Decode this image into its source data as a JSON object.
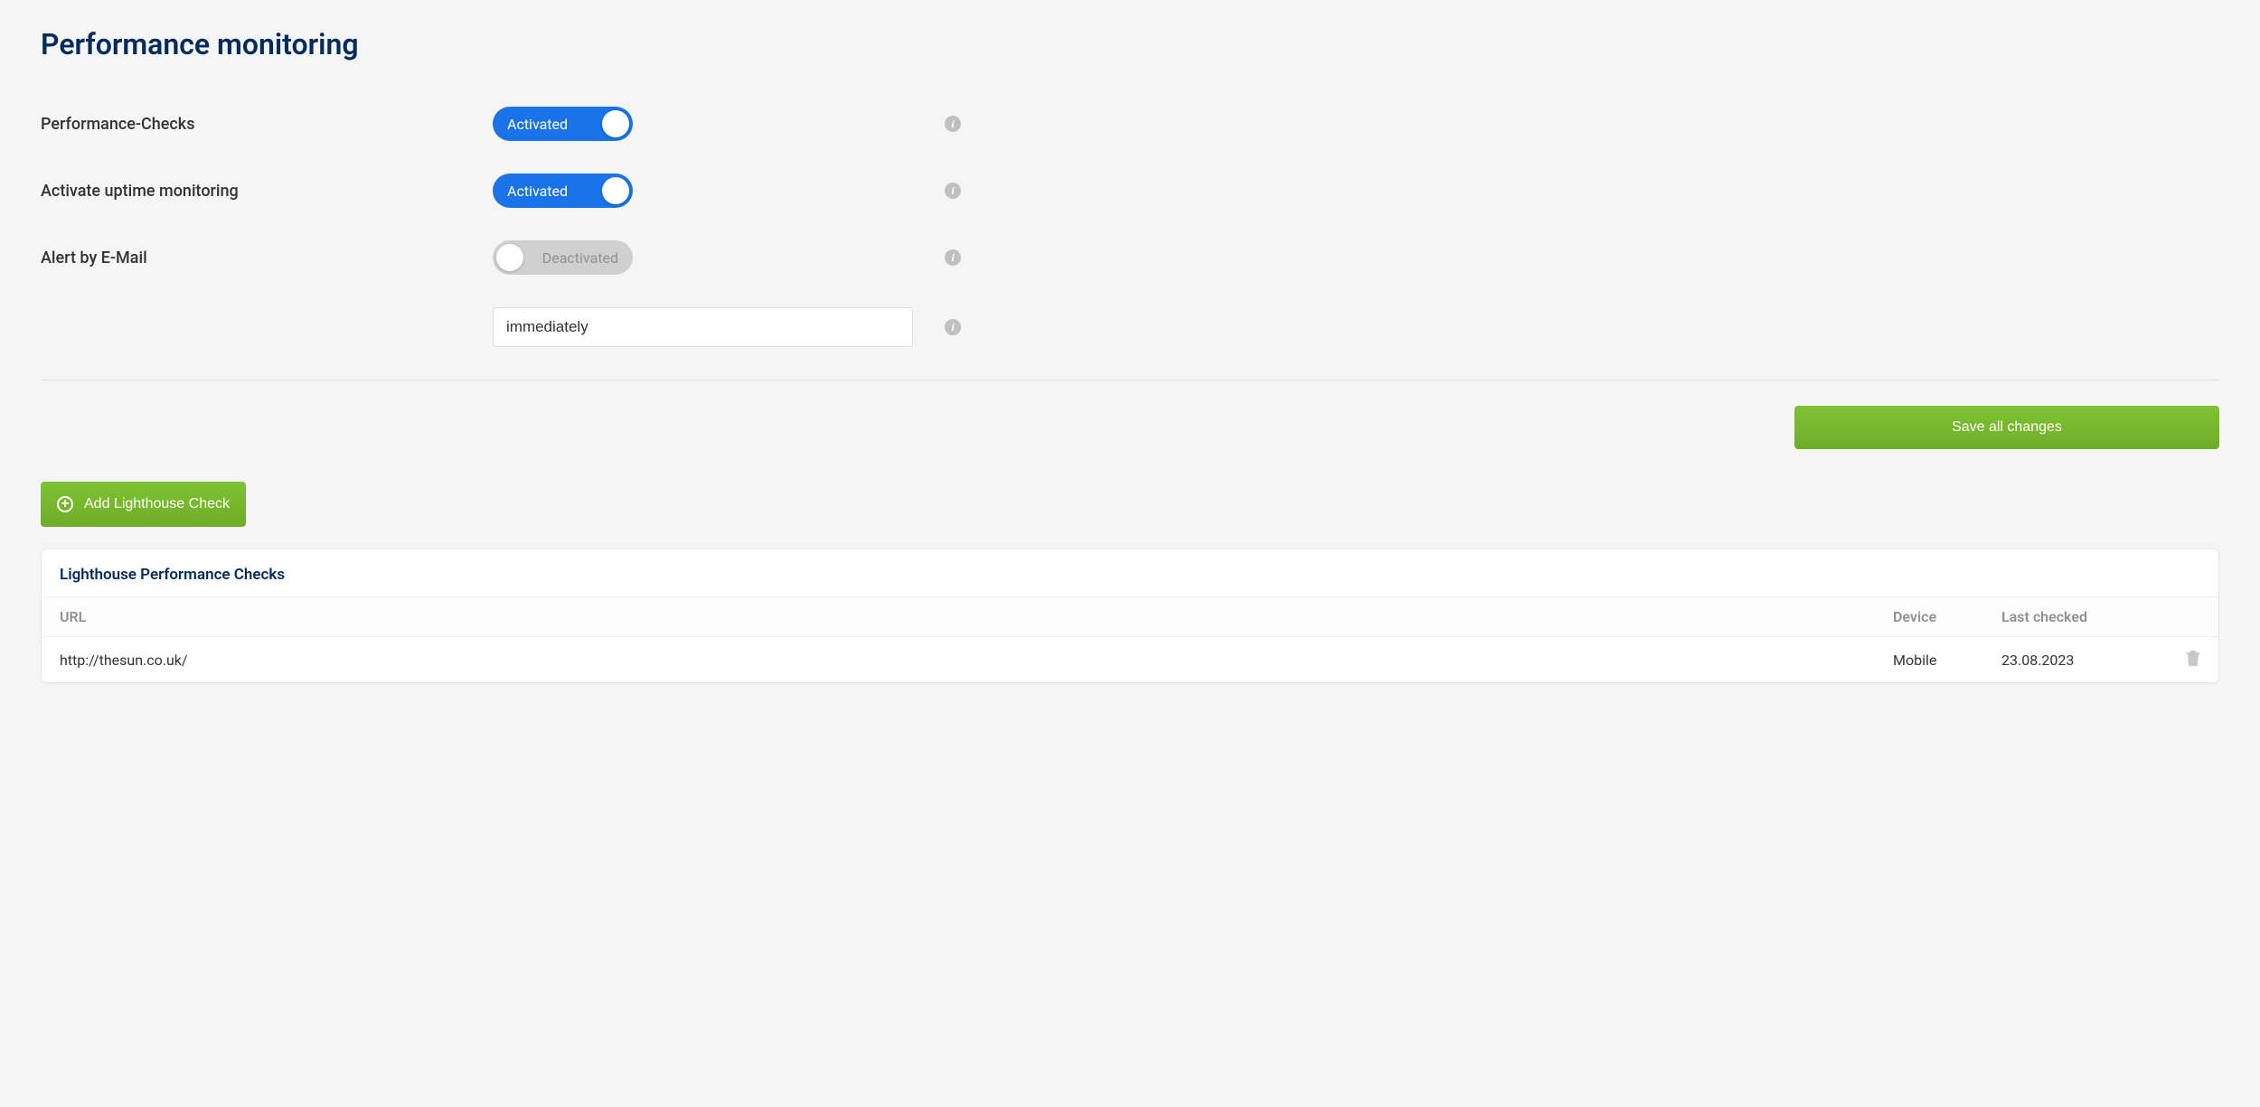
{
  "page": {
    "title": "Performance monitoring"
  },
  "settings": {
    "performance_checks": {
      "label": "Performance-Checks",
      "state_label": "Activated",
      "active": true
    },
    "uptime_monitoring": {
      "label": "Activate uptime monitoring",
      "state_label": "Activated",
      "active": true
    },
    "alert_email": {
      "label": "Alert by E-Mail",
      "state_label": "Deactivated",
      "active": false
    },
    "alert_frequency": {
      "value": "immediately"
    }
  },
  "buttons": {
    "save": "Save all changes",
    "add_check": "Add Lighthouse Check"
  },
  "checks_panel": {
    "title": "Lighthouse Performance Checks",
    "columns": {
      "url": "URL",
      "device": "Device",
      "last_checked": "Last checked"
    },
    "rows": [
      {
        "url": "http://thesun.co.uk/",
        "device": "Mobile",
        "last_checked": "23.08.2023"
      }
    ]
  }
}
